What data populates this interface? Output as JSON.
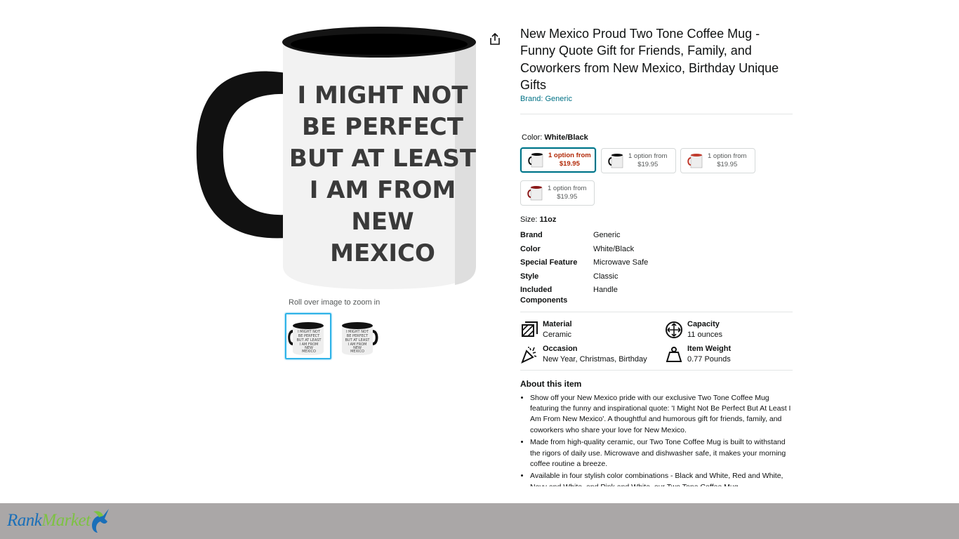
{
  "product": {
    "title": "New Mexico Proud Two Tone Coffee Mug - Funny Quote Gift for Friends, Family, and Coworkers from New Mexico, Birthday Unique Gifts",
    "brand_link": "Brand: Generic"
  },
  "gallery": {
    "main_image_icon": "mug-image",
    "mug_text": [
      "I MIGHT NOT",
      "BE PERFECT",
      "BUT AT LEAST",
      "I AM FROM",
      "NEW",
      "MEXICO"
    ],
    "zoom_hint": "Roll over image to zoom in",
    "thumbnails": [
      {
        "icon": "mug-thumbnail-front"
      },
      {
        "icon": "mug-thumbnail-side"
      }
    ]
  },
  "color": {
    "label": "Color:",
    "selected": "White/Black",
    "options": [
      {
        "line1": "1 option from",
        "line2": "$19.95",
        "accent": "#000000"
      },
      {
        "line1": "1 option from",
        "line2": "$19.95",
        "accent": "#000000"
      },
      {
        "line1": "1 option from",
        "line2": "$19.95",
        "accent": "#c0392b"
      },
      {
        "line1": "1 option from",
        "line2": "$19.95",
        "accent": "#8b1a1a"
      }
    ]
  },
  "size": {
    "label": "Size:",
    "value": "11oz"
  },
  "specs": [
    {
      "key": "Brand",
      "value": "Generic"
    },
    {
      "key": "Color",
      "value": "White/Black"
    },
    {
      "key": "Special Feature",
      "value": "Microwave Safe"
    },
    {
      "key": "Style",
      "value": "Classic"
    },
    {
      "key": "Included Components",
      "value": "Handle"
    }
  ],
  "features": [
    {
      "name": "Material",
      "value": "Ceramic",
      "icon": "material-icon"
    },
    {
      "name": "Capacity",
      "value": "11 ounces",
      "icon": "capacity-icon"
    },
    {
      "name": "Occasion",
      "value": "New Year, Christmas, Birthday",
      "icon": "occasion-icon"
    },
    {
      "name": "Item Weight",
      "value": "0.77 Pounds",
      "icon": "weight-icon"
    }
  ],
  "about": {
    "heading": "About this item",
    "bullets": [
      "Show off your New Mexico pride with our exclusive Two Tone Coffee Mug featuring the funny and inspirational quote: 'I Might Not Be Perfect But At Least I Am From New Mexico'. A thoughtful and humorous gift for friends, family, and coworkers who share your love for New Mexico.",
      "Made from high-quality ceramic, our Two Tone Coffee Mug is built to withstand the rigors of daily use. Microwave and dishwasher safe, it makes your morning coffee routine a breeze.",
      "Available in four stylish color combinations - Black and White, Red and White, Navy and White, and Pink and White, our Two Tone Coffee Mug"
    ]
  },
  "footer": {
    "logo_rank": "Rank",
    "logo_market": "Market",
    "logo_icon": "unicorn-logo-icon",
    "colors": {
      "rank": "#1a6fb8",
      "market": "#7dc242",
      "bar": "#aaa7a7"
    }
  },
  "colors": {
    "link": "#007185",
    "price_red": "#b12704",
    "selected_thumb": "#2fb3e8"
  }
}
